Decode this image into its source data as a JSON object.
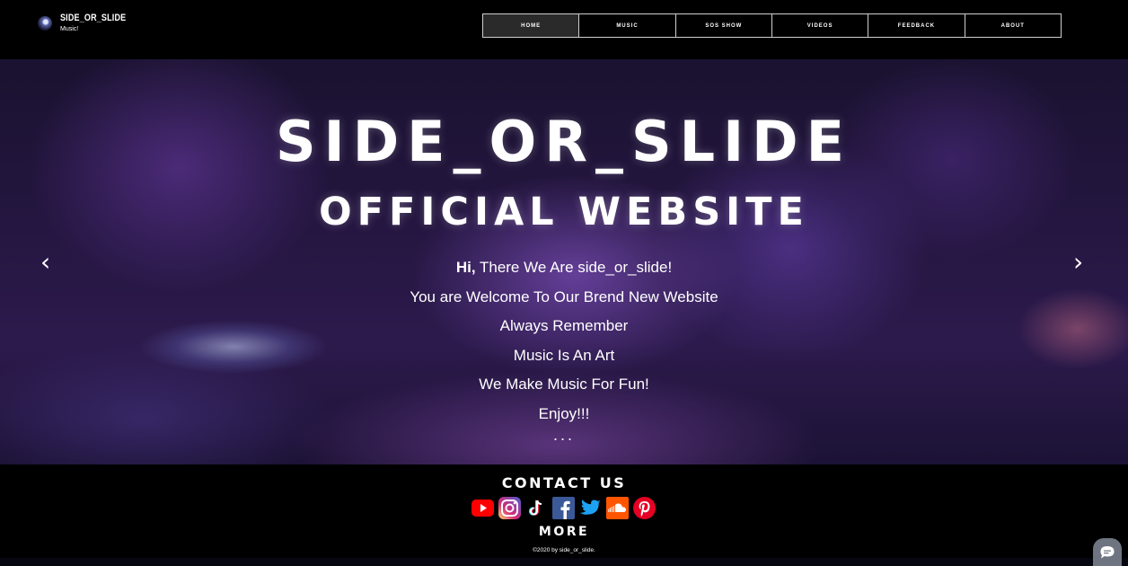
{
  "header": {
    "brand_title": "SIDE_OR_SLIDE",
    "brand_subtitle": "Music!",
    "nav": [
      {
        "label": "HOME",
        "active": true
      },
      {
        "label": "MUSIC",
        "active": false
      },
      {
        "label": "SOS SHOW",
        "active": false
      },
      {
        "label": "VIDEOS",
        "active": false
      },
      {
        "label": "FEEDBACK",
        "active": false
      },
      {
        "label": "ABOUT",
        "active": false
      }
    ]
  },
  "hero": {
    "title_line_1": "SIDE_OR_SLIDE",
    "title_line_2": "OFFICIAL WEBSITE",
    "greeting_bold": "Hi,",
    "greeting_rest": " There We Are side_or_slide!",
    "lines": [
      "You are Welcome To Our Brend New Website",
      "Always Remember",
      "Music Is An Art",
      "We Make Music For Fun!",
      "Enjoy!!!"
    ],
    "ellipsis": "...",
    "prev_arrow": "‹",
    "next_arrow": "›"
  },
  "footer": {
    "contact_title": "CONTACT US",
    "more_title": "MORE",
    "copyright": "©2020 by side_or_slide.",
    "social_icons": [
      "youtube-icon",
      "instagram-icon",
      "tiktok-icon",
      "facebook-icon",
      "twitter-icon",
      "soundcloud-icon",
      "pinterest-icon"
    ]
  },
  "colors": {
    "youtube": "#ff0000",
    "instagram": "#e1306c",
    "facebook": "#3b5998",
    "twitter": "#1da1f2",
    "soundcloud": "#ff5500",
    "pinterest": "#e60023",
    "chat_button": "#6e7480"
  }
}
